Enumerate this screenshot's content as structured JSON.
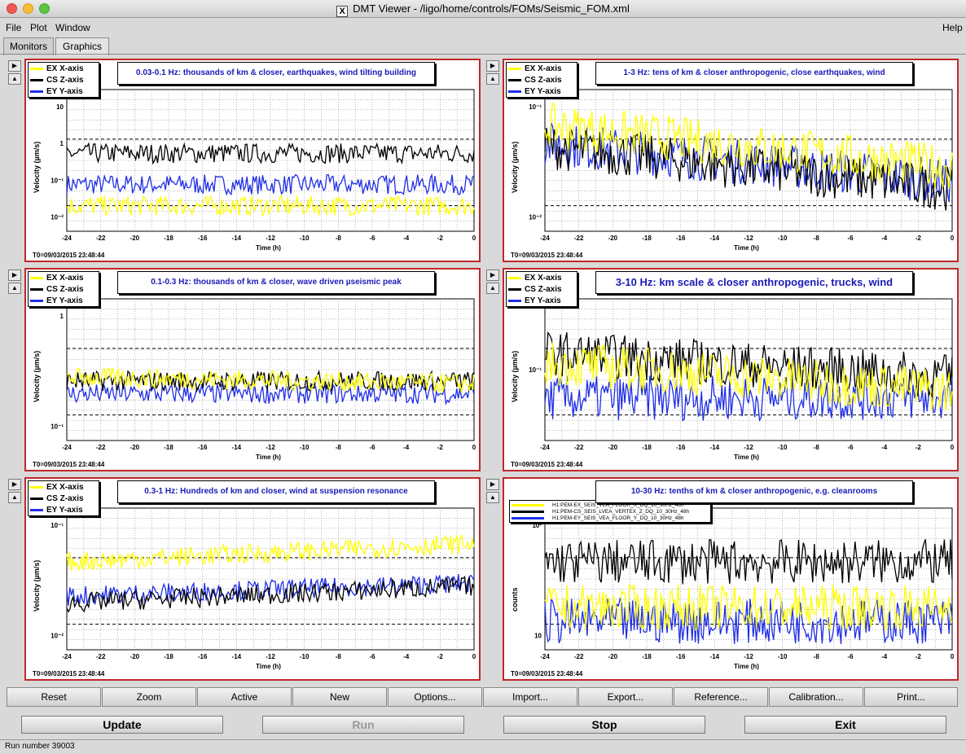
{
  "window": {
    "title": "DMT Viewer - /ligo/home/controls/FOMs/Seismic_FOM.xml",
    "x_logo": "X"
  },
  "menu": {
    "file": "File",
    "plot": "Plot",
    "window": "Window",
    "help": "Help"
  },
  "tabs": [
    "Monitors",
    "Graphics"
  ],
  "common": {
    "t0": "T0=09/03/2015 23:48:44",
    "xlabel": "Time (h)",
    "ylabel": "Velocity (µm/s)"
  },
  "colors": {
    "ex": "#ffff00",
    "cs": "#000000",
    "ey": "#1f2ee6",
    "frame": "#c0282a",
    "title_text": "#1a1ab8"
  },
  "panels": [
    {
      "title": "0.03-0.1 Hz: thousands of km & closer, earthquakes, wind tilting building",
      "legend": [
        "EX X-axis",
        "CS Z-axis",
        "EY Y-axis"
      ],
      "ylabel": "Velocity (µm/s)",
      "yticks": [
        "10",
        "1",
        "10⁻¹",
        "10⁻²"
      ]
    },
    {
      "title": "1-3 Hz: tens of km & closer anthropogenic, close earthquakes, wind",
      "legend": [
        "EX X-axis",
        "CS Z-axis",
        "EY Y-axis"
      ],
      "ylabel": "Velocity (µm/s)",
      "yticks": [
        "10⁻¹",
        "10⁻²"
      ]
    },
    {
      "title": "0.1-0.3 Hz: thousands of km & closer, wave driven µseismic peak",
      "legend": [
        "EX X-axis",
        "CS Z-axis",
        "EY Y-axis"
      ],
      "ylabel": "Velocity (µm/s)",
      "yticks": [
        "1",
        "10⁻¹"
      ]
    },
    {
      "title": "3-10 Hz: km scale & closer anthropogenic, trucks, wind",
      "legend": [
        "EX X-axis",
        "CS Z-axis",
        "EY Y-axis"
      ],
      "ylabel": "Velocity (µm/s)",
      "yticks": [
        "10⁻¹"
      ]
    },
    {
      "title": "0.3-1 Hz: Hundreds of km and closer, wind at suspension resonance",
      "legend": [
        "EX X-axis",
        "CS Z-axis",
        "EY Y-axis"
      ],
      "ylabel": "Velocity (µm/s)",
      "yticks": [
        "10⁻¹",
        "10⁻²"
      ]
    },
    {
      "title": "10-30 Hz: tenths of km & closer anthropogenic, e.g. cleanrooms",
      "legend": [
        "H1:PEM-EX_SEIS_VEA_FLOOR_X_DQ_10_30Hz_48h",
        "H1:PEM-CS_SEIS_LVEA_VERTEX_Z_DQ_10_30Hz_48h",
        "H1:PEM-EY_SEIS_VEA_FLOOR_Y_DQ_10_30Hz_48h"
      ],
      "ylabel": "counts",
      "yticks": [
        "10²",
        "10"
      ]
    }
  ],
  "xticks": [
    "-24",
    "-22",
    "-20",
    "-18",
    "-16",
    "-14",
    "-12",
    "-10",
    "-8",
    "-6",
    "-4",
    "-2",
    "0"
  ],
  "toolbar": [
    "Reset",
    "Zoom",
    "Active",
    "New",
    "Options...",
    "Import...",
    "Export...",
    "Reference...",
    "Calibration...",
    "Print..."
  ],
  "actions": {
    "update": "Update",
    "run": "Run",
    "stop": "Stop",
    "exit": "Exit"
  },
  "status": {
    "text": "Run number 39003"
  }
}
